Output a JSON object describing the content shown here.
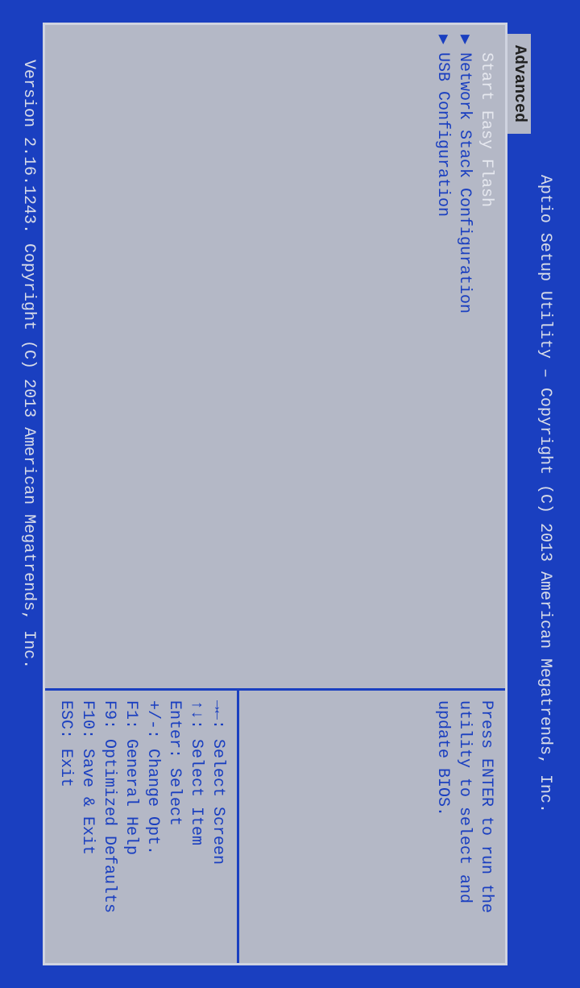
{
  "title": "Aptio Setup Utility – Copyright (C) 2013 American Megatrends, Inc.",
  "tab": {
    "advanced": "Advanced"
  },
  "menu": {
    "items": [
      {
        "label": "Start Easy Flash",
        "submenu": false,
        "selected": true
      },
      {
        "label": "Network Stack Configuration",
        "submenu": true,
        "selected": false
      },
      {
        "label": "USB Configuration",
        "submenu": true,
        "selected": false
      }
    ]
  },
  "help_text": "Press ENTER to run the utility to select and update BIOS.",
  "keys": [
    "→←: Select Screen",
    "↑↓: Select Item",
    "Enter: Select",
    "+/-: Change Opt.",
    "F1: General Help",
    "F9: Optimized Defaults",
    "F10: Save & Exit",
    "ESC: Exit"
  ],
  "footer": "Version 2.16.1243. Copyright (C) 2013 American Megatrends, Inc."
}
